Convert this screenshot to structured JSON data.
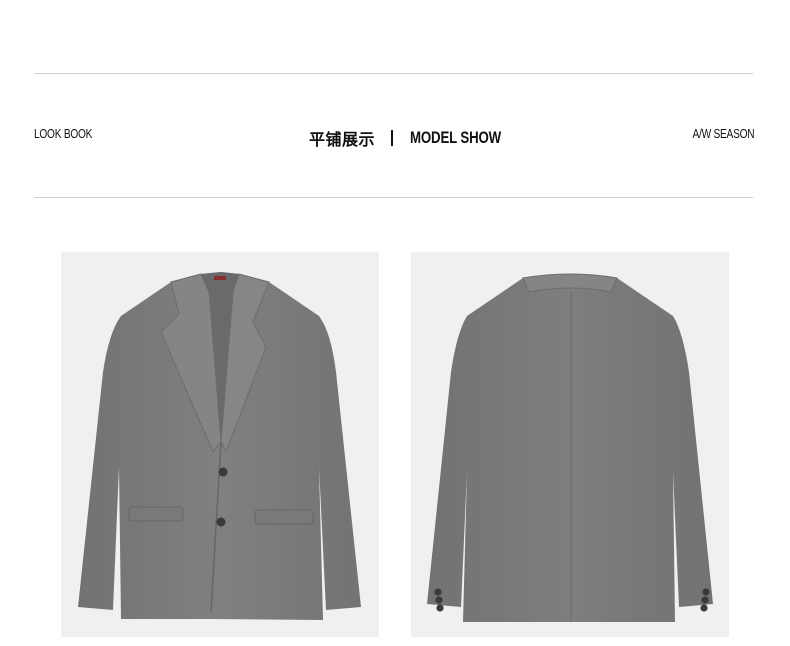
{
  "header": {
    "left_label": "LOOK BOOK",
    "title_cn": "平铺展示",
    "title_en": "MODEL SHOW",
    "right_label": "A/W SEASON"
  },
  "gallery": {
    "items": [
      {
        "view": "front",
        "color": "#7b7b7d"
      },
      {
        "view": "back",
        "color": "#7b7b7d"
      }
    ]
  },
  "colors": {
    "rule": "#cfcfcf",
    "photo_bg": "#eef0f1",
    "jacket": "#7b7b7d",
    "text": "#111111"
  }
}
